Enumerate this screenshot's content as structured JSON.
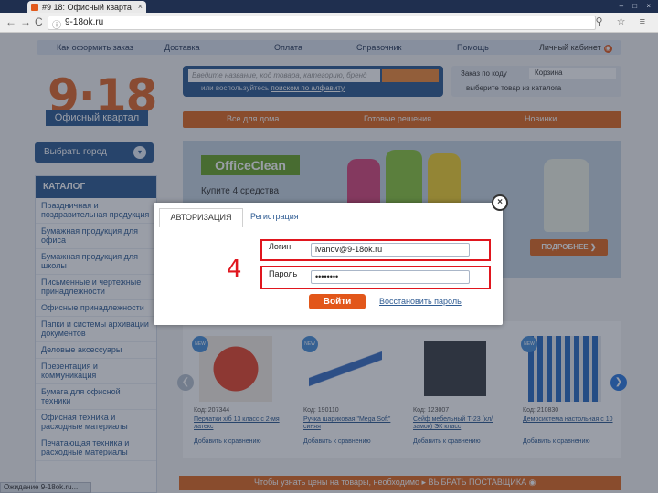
{
  "browser": {
    "tab_title": "#9 18: Офисный кварта",
    "tab_close": "×",
    "window_controls": "– □ ×",
    "back": "←",
    "forward": "→",
    "reload": "C",
    "url": "9-18ok.ru",
    "tools": "⚲ ☆ ≡",
    "status_text": "Ожидание 9-18ok.ru..."
  },
  "site": {
    "topnav": [
      "Как оформить заказ",
      "Доставка",
      "Оплата",
      "Справочник",
      "Помощь"
    ],
    "cabinet": {
      "label": "Личный кабинет",
      "icon": "◉"
    },
    "logo": {
      "text": "9·18",
      "subtitle": "Офисный квартал"
    },
    "search": {
      "placeholder": "Введите название, код товара, категорию, бренд",
      "alt_prefix": "или воспользуйтесь",
      "alt_link": "поиском по алфавиту"
    },
    "cart": {
      "order_by_code": "Заказ по коду",
      "cart_label": "Корзина",
      "choose": "выберите товар из каталога"
    },
    "orangebar": [
      "Все для дома",
      "Готовые решения",
      "Новинки"
    ],
    "city": {
      "label": "Выбрать город",
      "chevron": "▾"
    },
    "catalog": {
      "title": "КАТАЛОГ",
      "items": [
        "Праздничная и поздравительная продукция",
        "Бумажная продукция для офиса",
        "Бумажная продукция для школы",
        "Письменные и чертежные принадлежности",
        "Офисные принадлежности",
        "Папки и системы архивации документов",
        "Деловые аксессуары",
        "Презентация и коммуникация",
        "Бумага для офисной техники",
        "Офисная техника и расходные материалы",
        "Печатающая техника и расходные материалы"
      ]
    },
    "banner": {
      "brand": "OfficeClean",
      "promo": "Купите 4 средства",
      "more": "ПОДРОБНЕЕ ❯"
    },
    "products": [
      {
        "new": "NEW",
        "code": "Код: 207344",
        "name": "Перчатки х/б 13 класс с 2-мя латекс",
        "compare": "Добавить к сравнению"
      },
      {
        "new": "NEW",
        "code": "Код: 190110",
        "name": "Ручка шариковая \"Mega Soft\" синяя",
        "compare": "Добавить к сравнению"
      },
      {
        "new": "",
        "code": "Код: 123007",
        "name": "Сейф мебельный Т-23 (кл/замок) ЭК класс",
        "compare": "Добавить к сравнению"
      },
      {
        "new": "NEW",
        "code": "Код: 210830",
        "name": "Демосистема настольная с 10",
        "compare": "Добавить к сравнению"
      }
    ],
    "arrows": {
      "left": "❮",
      "right": "❯"
    },
    "pricebar": "Чтобы узнать цены на товары, необходимо ▸ ВЫБРАТЬ ПОСТАВЩИКА ◉"
  },
  "modal": {
    "tab_auth": "АВТОРИЗАЦИЯ",
    "tab_reg": "Регистрация",
    "login_label": "Логин:",
    "login_value": "ivanov@9-18ok.ru",
    "password_label": "Пароль",
    "password_value": "••••••••",
    "submit": "Войти",
    "restore": "Восстановить пароль",
    "close": "×"
  },
  "annotation": {
    "step": "4",
    "highlight_color": "#e0161e"
  },
  "colors": {
    "brand_blue": "#2f5c93",
    "brand_orange": "#e06a22"
  }
}
